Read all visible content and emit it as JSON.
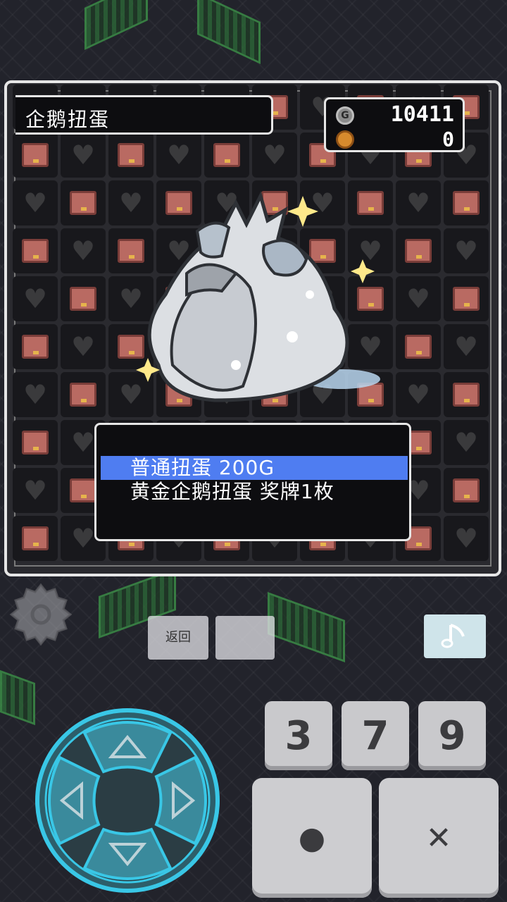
{
  "header": {
    "title": "企鹅扭蛋"
  },
  "currency": {
    "gold": "10411",
    "medals": "0",
    "gold_icon_letter": "G"
  },
  "menu": {
    "items": [
      {
        "label": "普通扭蛋 200G",
        "selected": true
      },
      {
        "label": "黄金企鹅扭蛋 奖牌1枚",
        "selected": false
      }
    ],
    "highlight_color": "#4f7df1"
  },
  "controls": {
    "back_label": "返回",
    "blank_label": "",
    "music_icon": "music-note-icon",
    "num_buttons": [
      "3",
      "7",
      "9"
    ],
    "confirm_glyph": "●",
    "cancel_glyph": "✕"
  },
  "colors": {
    "chest": "#b96a62",
    "frame": "#e6e6e6",
    "dpad_glow": "#39c7e6"
  }
}
